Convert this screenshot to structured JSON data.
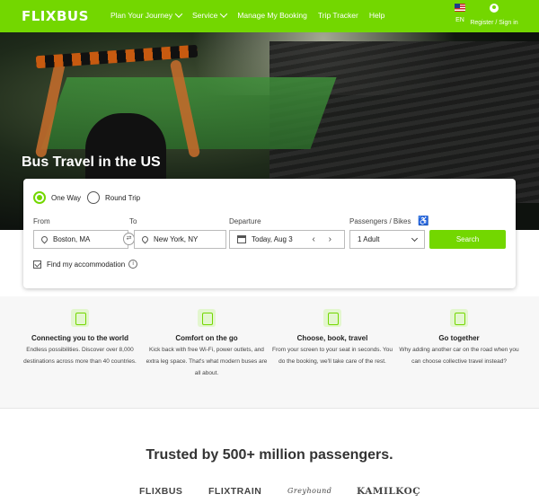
{
  "header": {
    "logo": "FLIXBUS",
    "nav": [
      {
        "label": "Plan Your Journey",
        "dropdown": true
      },
      {
        "label": "Service",
        "dropdown": true
      },
      {
        "label": "Manage My Booking",
        "dropdown": false
      },
      {
        "label": "Trip Tracker",
        "dropdown": false
      },
      {
        "label": "Help",
        "dropdown": false
      }
    ],
    "language": "EN",
    "account": "Register / Sign in"
  },
  "hero": {
    "title": "Bus Travel in the US"
  },
  "search": {
    "trip_types": [
      "One Way",
      "Round Trip"
    ],
    "selected_trip_type": "One Way",
    "from_label": "From",
    "to_label": "To",
    "from_value": "Boston, MA",
    "to_value": "New York, NY",
    "departure_label": "Departure",
    "departure_value": "Today, Aug 3",
    "passengers_label": "Passengers / Bikes",
    "passengers_value": "1 Adult",
    "search_button": "Search",
    "accommodation_label": "Find my accommodation",
    "accommodation_checked": true
  },
  "features": [
    {
      "title": "Connecting you to the world",
      "text": "Endless possibilities. Discover over 8,000 destinations across more than 40 countries."
    },
    {
      "title": "Comfort on the go",
      "text": "Kick back with free Wi-Fi, power outlets, and extra leg space. That's what modern buses are all about."
    },
    {
      "title": "Choose, book, travel",
      "text": "From your screen to your seat in seconds. You do the booking, we'll take care of the rest."
    },
    {
      "title": "Go together",
      "text": "Why adding another car on the road when you can choose collective travel instead?"
    }
  ],
  "trusted": {
    "title": "Trusted by 500+ million passengers.",
    "brands": [
      "FLIXBUS",
      "FLIXTRAIN",
      "Greyhound",
      "KAMILKOÇ"
    ]
  },
  "colors": {
    "brand_green": "#73d700"
  }
}
